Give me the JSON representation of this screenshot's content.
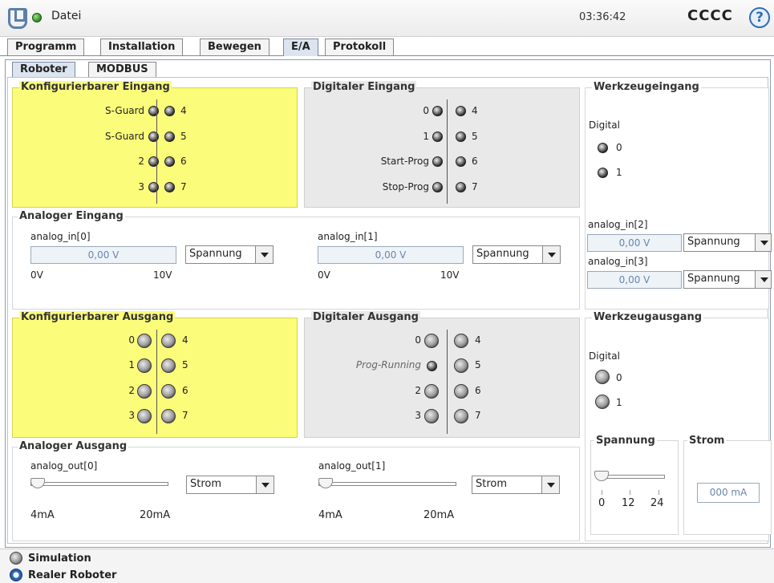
{
  "header": {
    "file_label": "Datei",
    "clock": "03:36:42",
    "robot_name": "CCCC",
    "help": "?"
  },
  "tabs": [
    "Programm",
    "Installation",
    "Bewegen",
    "E/A",
    "Protokoll"
  ],
  "subtabs": [
    "Roboter",
    "MODBUS"
  ],
  "configurable_input": {
    "title": "Konfigurierbarer Eingang",
    "left": [
      "S-Guard",
      "S-Guard",
      "2",
      "3"
    ],
    "right": [
      "4",
      "5",
      "6",
      "7"
    ]
  },
  "digital_input": {
    "title": "Digitaler Eingang",
    "left": [
      "0",
      "1",
      "Start-Prog",
      "Stop-Prog"
    ],
    "right": [
      "4",
      "5",
      "6",
      "7"
    ]
  },
  "tool_input": {
    "title": "Werkzeugeingang",
    "digital_label": "Digital",
    "digital": [
      "0",
      "1"
    ],
    "analog": [
      {
        "label": "analog_in[2]",
        "value": "0,00 V",
        "mode": "Spannung"
      },
      {
        "label": "analog_in[3]",
        "value": "0,00 V",
        "mode": "Spannung"
      }
    ]
  },
  "analog_input": {
    "title": "Analoger Eingang",
    "channels": [
      {
        "label": "analog_in[0]",
        "value": "0,00 V",
        "mode": "Spannung",
        "min": "0V",
        "max": "10V"
      },
      {
        "label": "analog_in[1]",
        "value": "0,00 V",
        "mode": "Spannung",
        "min": "0V",
        "max": "10V"
      }
    ]
  },
  "configurable_output": {
    "title": "Konfigurierbarer Ausgang",
    "left": [
      "0",
      "1",
      "2",
      "3"
    ],
    "right": [
      "4",
      "5",
      "6",
      "7"
    ]
  },
  "digital_output": {
    "title": "Digitaler Ausgang",
    "left": [
      "0",
      "Prog-Running",
      "2",
      "3"
    ],
    "right": [
      "4",
      "5",
      "6",
      "7"
    ]
  },
  "tool_output": {
    "title": "Werkzeugausgang",
    "digital_label": "Digital",
    "digital": [
      "0",
      "1"
    ],
    "voltage": {
      "title": "Spannung",
      "ticks": [
        "0",
        "12",
        "24"
      ],
      "level": 0
    },
    "current": {
      "title": "Strom",
      "value": "000 mA"
    }
  },
  "analog_output": {
    "title": "Analoger Ausgang",
    "channels": [
      {
        "label": "analog_out[0]",
        "mode": "Strom",
        "min": "4mA",
        "max": "20mA",
        "level": 0
      },
      {
        "label": "analog_out[1]",
        "mode": "Strom",
        "min": "4mA",
        "max": "20mA",
        "level": 0
      }
    ]
  },
  "footer": {
    "simulation": "Simulation",
    "real_robot": "Realer Roboter"
  }
}
